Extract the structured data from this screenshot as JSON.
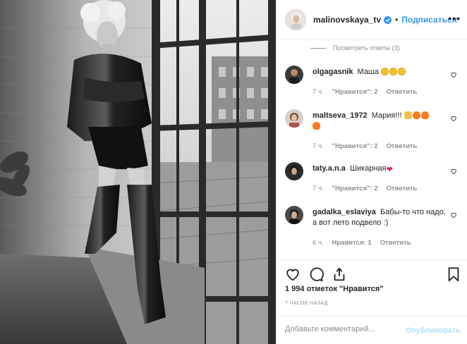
{
  "post": {
    "username": "malinovskaya_tv",
    "separator": "•",
    "follow_label": "Подписаться",
    "more_label": "•••",
    "icons": {
      "verified": "verified-badge-icon",
      "more": "more-options-icon"
    }
  },
  "view_replies": "Посмотреть ответы (3)",
  "comments": [
    {
      "user": "olgagasnik",
      "text": "Маша",
      "emojis": [
        "laugh",
        "laugh",
        "laugh"
      ],
      "time": "7 ч.",
      "likes": "\"Нравится\": 2",
      "reply": "Ответить"
    },
    {
      "user": "maltseva_1972",
      "text": "Мария!!!",
      "emojis": [
        "thumb",
        "fire",
        "fire",
        "fire"
      ],
      "time": "7 ч.",
      "likes": "\"Нравится\": 2",
      "reply": "Ответить"
    },
    {
      "user": "taty.a.n.a",
      "text": "Шикарная",
      "emojis": [
        "heart"
      ],
      "time": "7 ч.",
      "likes": "\"Нравится\": 2",
      "reply": "Ответить"
    },
    {
      "user": "gadalka_eslaviya",
      "text": "Бабы-то что надо, а вот лето подвело :)",
      "emojis": [],
      "time": "6 ч.",
      "likes": "Нравится: 1",
      "reply": "Ответить"
    }
  ],
  "actions": {
    "likes_count": "1 994 отметок \"Нравится\"",
    "time_ago": "7 ЧАСОВ НАЗАД",
    "icons": [
      "heart-icon",
      "comment-icon",
      "share-icon",
      "bookmark-icon"
    ]
  },
  "add_comment": {
    "placeholder": "Добавьте комментарий...",
    "publish_label": "Опубликовать"
  },
  "colors": {
    "accent": "#3897f0",
    "publish_disabled": "#b2dffc",
    "muted": "#8e8e8e",
    "border": "#efefef"
  }
}
